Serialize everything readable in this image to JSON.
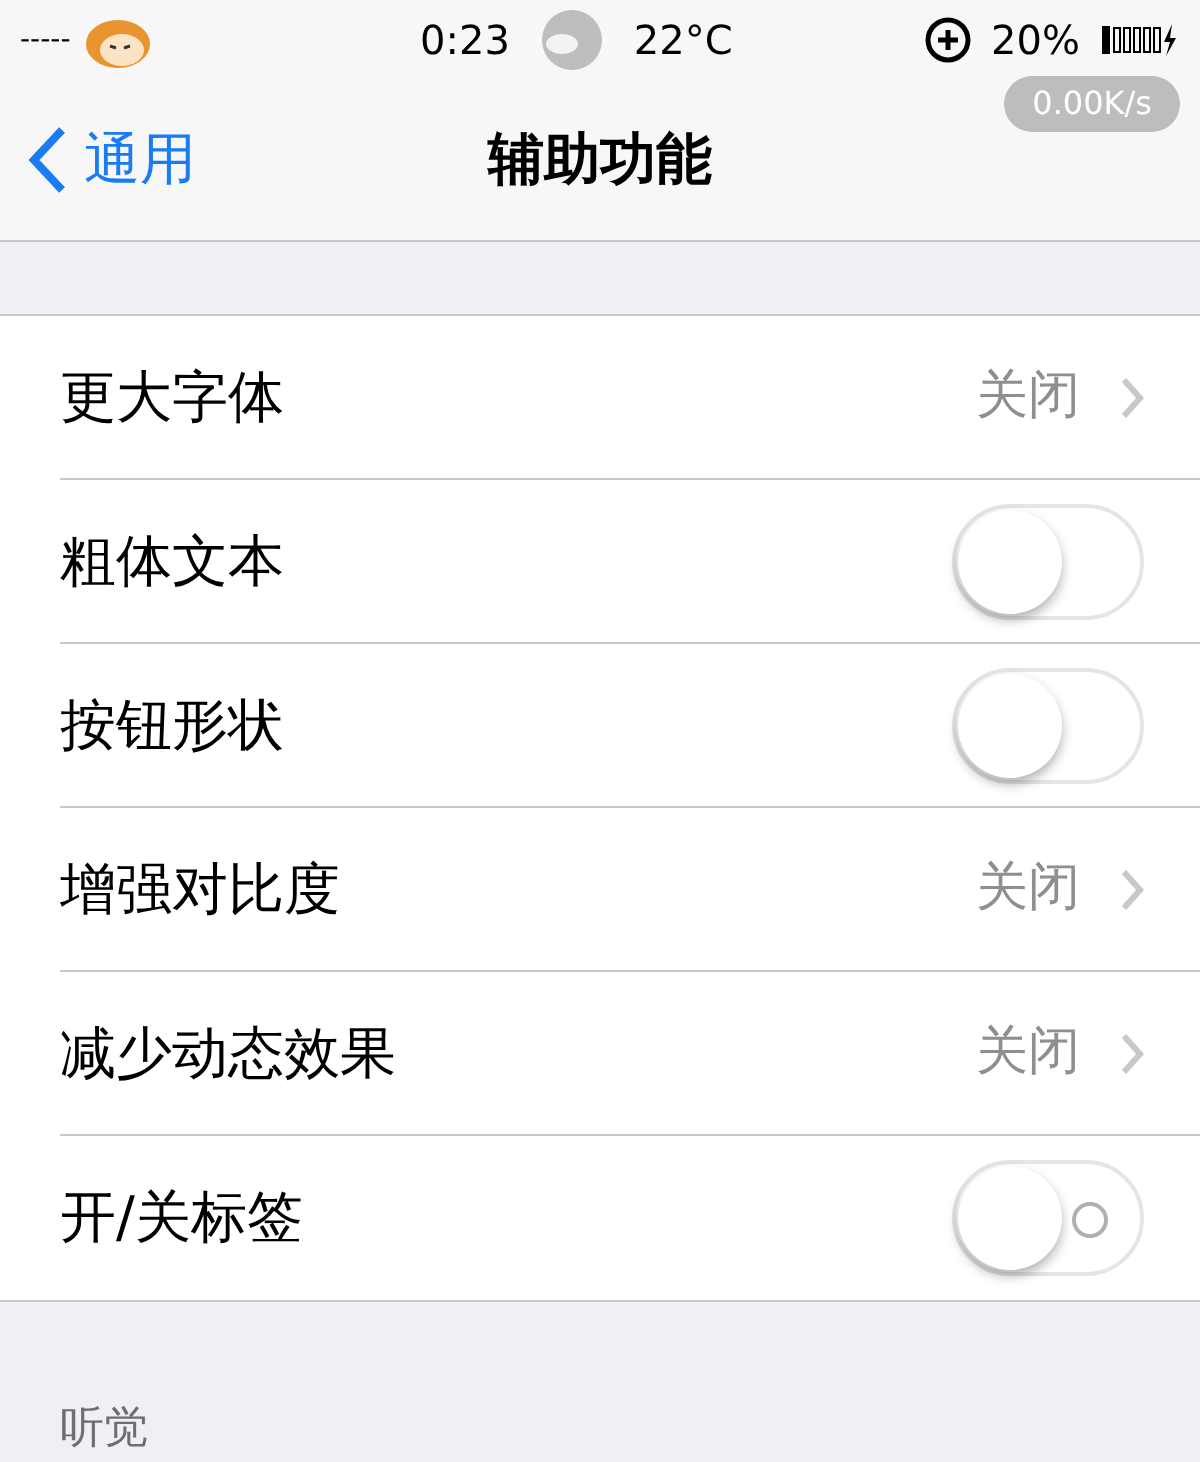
{
  "status_bar": {
    "signal": "-----",
    "time": "0:23",
    "temperature": "22°C",
    "battery": "20%",
    "speed": "0.00K/s"
  },
  "nav": {
    "back": "通用",
    "title": "辅助功能"
  },
  "rows": [
    {
      "kind": "link",
      "label": "更大字体",
      "value": "关闭"
    },
    {
      "kind": "switch",
      "label": "粗体文本",
      "on": false,
      "labels": false
    },
    {
      "kind": "switch",
      "label": "按钮形状",
      "on": false,
      "labels": false
    },
    {
      "kind": "link",
      "label": "增强对比度",
      "value": "关闭"
    },
    {
      "kind": "link",
      "label": "减少动态效果",
      "value": "关闭"
    },
    {
      "kind": "switch",
      "label": "开/关标签",
      "on": false,
      "labels": true
    }
  ],
  "next_section": {
    "header": "听觉"
  }
}
